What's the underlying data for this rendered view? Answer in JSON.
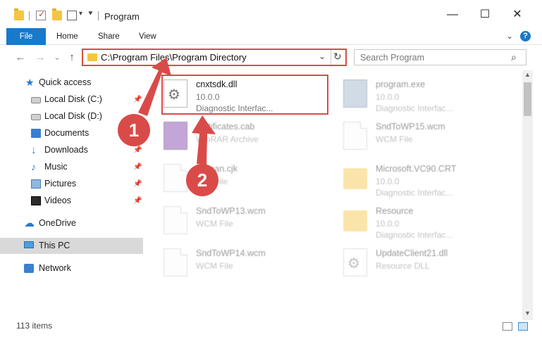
{
  "window": {
    "title": "Program",
    "minimize": "—",
    "maximize": "☐",
    "close": "✕"
  },
  "ribbon": {
    "tabs": [
      "File",
      "Home",
      "Share",
      "View"
    ],
    "expand": "⌄",
    "help": "?"
  },
  "nav": {
    "back": "←",
    "forward": "→",
    "recent": "⌄",
    "up": "↑",
    "address": "C:\\Program Files\\Program Directory",
    "address_dropdown": "⌄",
    "refresh": "↻",
    "search_placeholder": "Search Program",
    "search_icon": "⌕"
  },
  "sidebar": {
    "items": [
      {
        "label": "Quick access",
        "icon": "star-icon",
        "pinned": false
      },
      {
        "label": "Local Disk (C:)",
        "icon": "drive-icon",
        "pinned": true
      },
      {
        "label": "Local Disk (D:)",
        "icon": "drive-icon",
        "pinned": false
      },
      {
        "label": "Documents",
        "icon": "documents-icon",
        "pinned": true
      },
      {
        "label": "Downloads",
        "icon": "download-icon",
        "pinned": true
      },
      {
        "label": "Music",
        "icon": "music-icon",
        "pinned": true
      },
      {
        "label": "Pictures",
        "icon": "pictures-icon",
        "pinned": true
      },
      {
        "label": "Videos",
        "icon": "videos-icon",
        "pinned": true
      },
      {
        "label": "OneDrive",
        "icon": "cloud-icon",
        "pinned": false
      },
      {
        "label": "This PC",
        "icon": "computer-icon",
        "pinned": false,
        "selected": true
      },
      {
        "label": "Network",
        "icon": "network-icon",
        "pinned": false
      }
    ]
  },
  "files": [
    {
      "name": "cnxtsdk.dll",
      "line2": "10.0.0",
      "line3": "Diagnostic Interfac...",
      "icon": "dll-gear-icon",
      "highlighted": true
    },
    {
      "name": "program.exe",
      "line2": "10.0.0",
      "line3": "Diagnostic Interfac...",
      "icon": "exe-icon"
    },
    {
      "name": "certificates.cab",
      "line2": "WinRAR Archive",
      "line3": "",
      "icon": "archive-icon"
    },
    {
      "name": "SndToWP15.wcm",
      "line2": "WCM File",
      "line3": "",
      "icon": "document-icon"
    },
    {
      "name": "Korean.cjk",
      "line2": "CJK File",
      "line3": "",
      "icon": "document-icon"
    },
    {
      "name": "Microsoft.VC90.CRT",
      "line2": "10.0.0",
      "line3": "Diagnostic Interfac...",
      "icon": "folder-icon"
    },
    {
      "name": "SndToWP13.wcm",
      "line2": "WCM File",
      "line3": "",
      "icon": "document-icon"
    },
    {
      "name": "Resource",
      "line2": "10.0.0",
      "line3": "Diagnostic Interfac...",
      "icon": "folder-icon"
    },
    {
      "name": "SndToWP14.wcm",
      "line2": "WCM File",
      "line3": "",
      "icon": "document-icon"
    },
    {
      "name": "UpdateClient21.dll",
      "line2": "Resource DLL",
      "line3": "",
      "icon": "dll-gear-icon"
    }
  ],
  "status": {
    "item_count": "113 items"
  },
  "annotations": {
    "step1": "1",
    "step2": "2",
    "color": "#d94b48"
  }
}
